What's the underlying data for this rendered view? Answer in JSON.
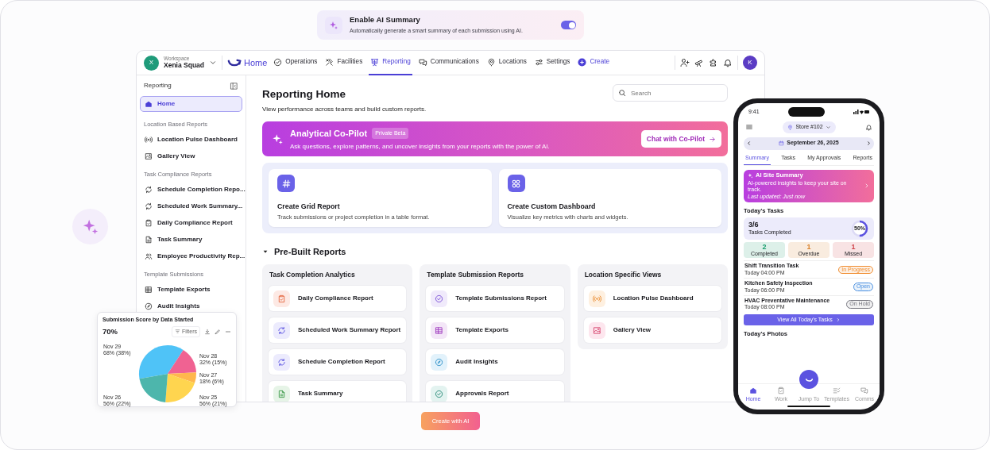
{
  "ai_summary": {
    "title": "Enable AI Summary",
    "description": "Automatically generate a smart summary of each submission using AI.",
    "on": true
  },
  "navbar": {
    "workspace_label": "Workspace",
    "workspace_name": "Xenia Squad",
    "workspace_initial": "X",
    "home": "Home",
    "items": [
      {
        "label": "Operations",
        "selected": false
      },
      {
        "label": "Facilities",
        "selected": false
      },
      {
        "label": "Reporting",
        "selected": true
      },
      {
        "label": "Communications",
        "selected": false
      },
      {
        "label": "Locations",
        "selected": false
      },
      {
        "label": "Settings",
        "selected": false
      }
    ],
    "create": "Create",
    "user_initial": "K"
  },
  "sidebar": {
    "title": "Reporting",
    "items": [
      {
        "kind": "item",
        "label": "Home",
        "selected": true
      },
      {
        "kind": "heading",
        "label": "Location Based Reports"
      },
      {
        "kind": "item",
        "label": "Location Pulse Dashboard",
        "selected": false
      },
      {
        "kind": "item",
        "label": "Gallery View",
        "selected": false
      },
      {
        "kind": "heading",
        "label": "Task Compliance Reports"
      },
      {
        "kind": "item",
        "label": "Schedule Completion Repo...",
        "selected": false
      },
      {
        "kind": "item",
        "label": "Scheduled Work Summary...",
        "selected": false
      },
      {
        "kind": "item",
        "label": "Daily Compliance Report",
        "selected": false
      },
      {
        "kind": "item",
        "label": "Task Summary",
        "selected": false
      },
      {
        "kind": "item",
        "label": "Employee Productivity Rep...",
        "selected": false
      },
      {
        "kind": "heading",
        "label": "Template Submissions"
      },
      {
        "kind": "item",
        "label": "Template Exports",
        "selected": false
      },
      {
        "kind": "item",
        "label": "Audit Insights",
        "selected": false
      }
    ]
  },
  "main": {
    "title": "Reporting Home",
    "subtitle": "View performance across teams and build custom reports.",
    "search": {
      "placeholder": "Search"
    },
    "copilot": {
      "title": "Analytical Co-Pilot",
      "badge": "Private Beta",
      "description": "Ask questions, explore patterns, and uncover insights from your reports with the power of AI.",
      "button": "Chat with Co-Pilot"
    },
    "create_cards": [
      {
        "title": "Create Grid Report",
        "description": "Track submissions or project completion in a table format."
      },
      {
        "title": "Create Custom Dashboard",
        "description": "Visualize key metrics with charts and widgets."
      }
    ],
    "prebuilt": {
      "title": "Pre-Built Reports",
      "expanded": true,
      "groups": [
        {
          "title": "Task Completion Analytics",
          "items": [
            "Daily Compliance Report",
            "Scheduled Work Summary Report",
            "Schedule Completion Report",
            "Task Summary"
          ]
        },
        {
          "title": "Template Submission Reports",
          "items": [
            "Template Submissions Report",
            "Template Exports",
            "Audit Insights",
            "Approvals Report"
          ]
        },
        {
          "title": "Location Specific Views",
          "items": [
            "Location Pulse Dashboard",
            "Gallery View"
          ]
        }
      ]
    }
  },
  "chart_card": {
    "filters": "Filters",
    "summary_value": "70%",
    "chart_data": {
      "type": "pie",
      "title": "Submission Score by Data Started",
      "categories": [
        "Nov 29",
        "Nov 28",
        "Nov 27",
        "Nov 25",
        "Nov 26"
      ],
      "series": [
        {
          "values": [
            37,
            15,
            6,
            21,
            21
          ]
        }
      ],
      "value_labels": [
        "68% (38%)",
        "32% (15%)",
        "18% (6%)",
        "56% (21%)",
        "56% (22%)"
      ]
    }
  },
  "phone": {
    "time": "9:41",
    "store": "Store #102",
    "date": "September 26, 2025",
    "tabs": [
      {
        "label": "Summary",
        "selected": true
      },
      {
        "label": "Tasks",
        "selected": false
      },
      {
        "label": "My Approvals",
        "selected": false
      },
      {
        "label": "Reports",
        "selected": false
      }
    ],
    "ai_card": {
      "title": "AI Site Summary",
      "description": "AI-powered insights to keep your site on track.",
      "updated": "Last updated: Just now"
    },
    "section": "Today's Tasks",
    "progress": {
      "count": "3/6",
      "label": "Tasks Completed",
      "percent": "50%",
      "level": 0.5
    },
    "stats": [
      {
        "value": "2",
        "label": "Completed",
        "color": "#1a9e6e"
      },
      {
        "value": "1",
        "label": "Overdue",
        "color": "#d9822b"
      },
      {
        "value": "1",
        "label": "Missed",
        "color": "#d0454c"
      }
    ],
    "tasks": [
      {
        "title": "Shift Transition Task",
        "time": "Today 04:00 PM",
        "status": "In Progress",
        "color": "#f08c2e"
      },
      {
        "title": "Kitchen Safety Inspection",
        "time": "Today 06:00 PM",
        "status": "Open",
        "color": "#4a8fe0"
      },
      {
        "title": "HVAC Preventative Maintenance",
        "time": "Today 08:00 PM",
        "status": "On Hold",
        "color": "#777780"
      }
    ],
    "view_all": "View All Today's Tasks",
    "next_section": "Today's Photos",
    "bottom_tabs": [
      {
        "label": "Home",
        "selected": true
      },
      {
        "label": "Work",
        "selected": false
      },
      {
        "label": "Jump To",
        "selected": false
      },
      {
        "label": "Templates",
        "selected": false
      },
      {
        "label": "Comms",
        "selected": false
      }
    ]
  },
  "create_ai_button": "Create with AI"
}
